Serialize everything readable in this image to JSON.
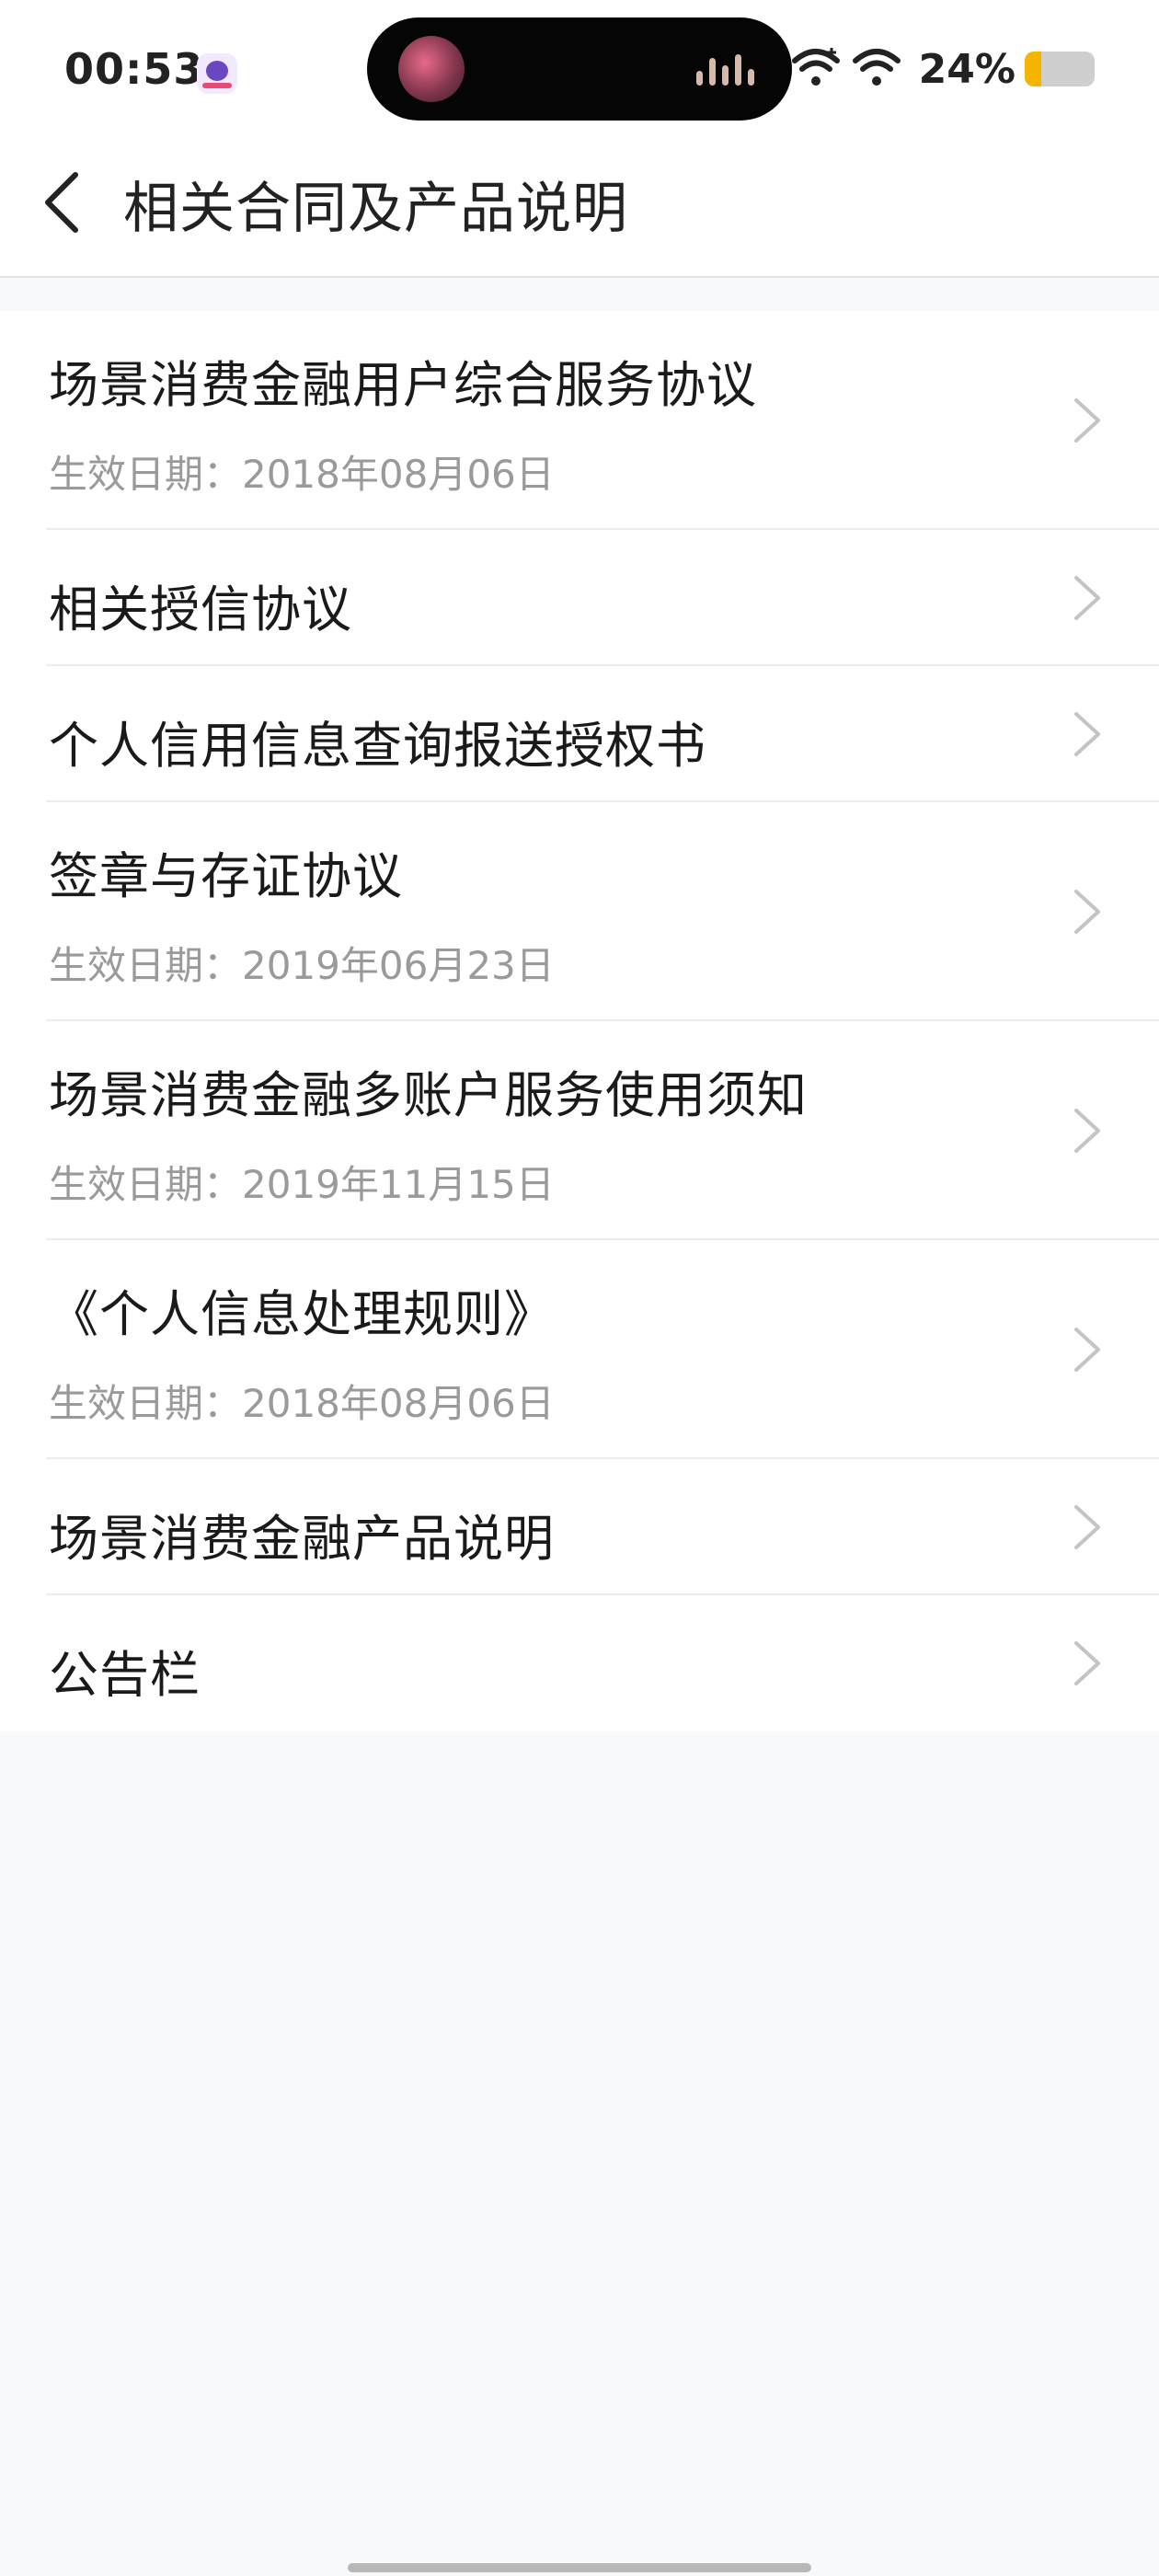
{
  "status_bar": {
    "time": "00:53",
    "battery_percent": "24%",
    "battery_level": 0.24,
    "icons": [
      "app-notification-icon",
      "hotspot-wifi-icon",
      "wifi-icon",
      "battery-icon"
    ]
  },
  "header": {
    "title": "相关合同及产品说明",
    "back_icon": "chevron-left-icon"
  },
  "items": [
    {
      "title": "场景消费金融用户综合服务协议",
      "date": "生效日期：2018年08月06日"
    },
    {
      "title": "相关授信协议"
    },
    {
      "title": "个人信用信息查询报送授权书"
    },
    {
      "title": "签章与存证协议",
      "date": "生效日期：2019年06月23日"
    },
    {
      "title": "场景消费金融多账户服务使用须知",
      "date": "生效日期：2019年11月15日"
    },
    {
      "title": "《个人信息处理规则》",
      "date": "生效日期：2018年08月06日"
    },
    {
      "title": "场景消费金融产品说明"
    },
    {
      "title": "公告栏"
    }
  ],
  "colors": {
    "background": "#f8f9fb",
    "title_text": "#1a1a1a",
    "secondary_text": "#9a9a9a",
    "battery_fill": "#f5b400"
  }
}
